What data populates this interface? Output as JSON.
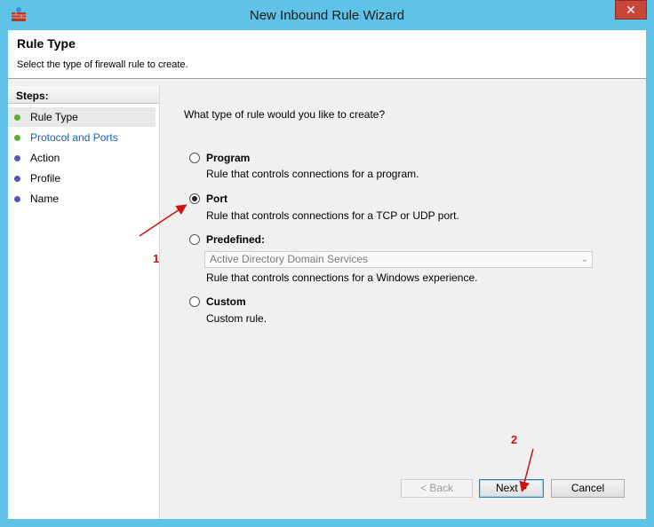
{
  "window": {
    "title": "New Inbound Rule Wizard",
    "close_symbol": "✕",
    "accent": "#5fc3e8"
  },
  "header": {
    "title": "Rule Type",
    "subtitle": "Select the type of firewall rule to create."
  },
  "steps": {
    "heading": "Steps:",
    "items": [
      {
        "label": "Rule Type",
        "dot_color": "#5cb030"
      },
      {
        "label": "Protocol and Ports",
        "dot_color": "#5cb030"
      },
      {
        "label": "Action",
        "dot_color": "#5555c0"
      },
      {
        "label": "Profile",
        "dot_color": "#5555c0"
      },
      {
        "label": "Name",
        "dot_color": "#5555c0"
      }
    ]
  },
  "main": {
    "question": "What type of rule would you like to create?",
    "options": [
      {
        "label": "Program",
        "desc": "Rule that controls connections for a program.",
        "selected": false
      },
      {
        "label": "Port",
        "desc": "Rule that controls connections for a TCP or UDP port.",
        "selected": true
      },
      {
        "label": "Predefined:",
        "desc": "Rule that controls connections for a Windows experience.",
        "selected": false
      },
      {
        "label": "Custom",
        "desc": "Custom rule.",
        "selected": false
      }
    ],
    "predefined_select_value": "Active Directory Domain Services"
  },
  "buttons": {
    "back": "< Back",
    "next": "Next >",
    "cancel": "Cancel"
  },
  "annotations": {
    "marker_1": "1",
    "marker_2": "2",
    "color": "#d11010"
  }
}
